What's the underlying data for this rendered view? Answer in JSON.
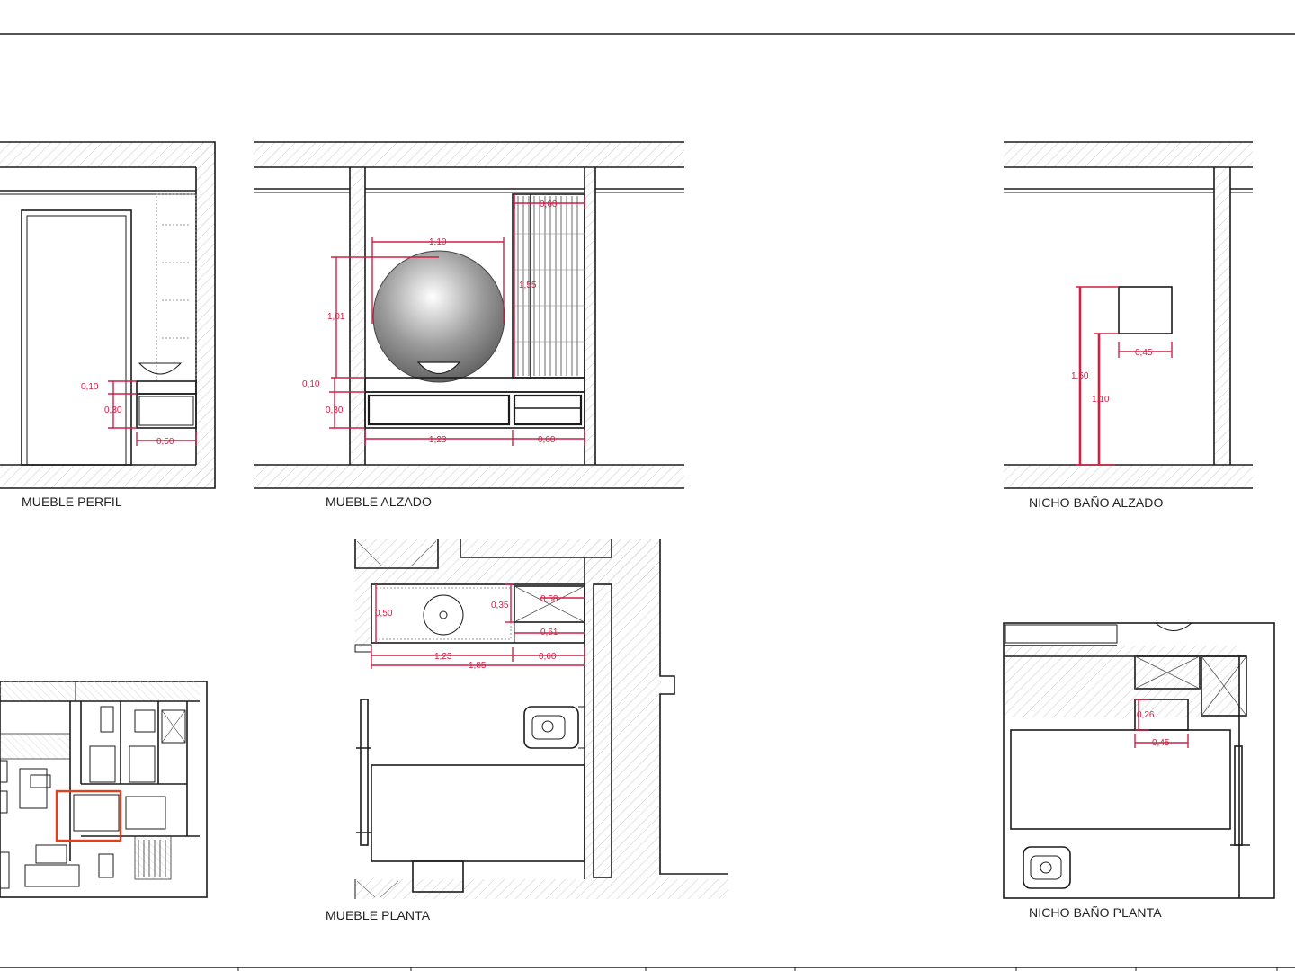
{
  "drawing_titles": {
    "profile": "MUEBLE PERFIL",
    "elevation": "MUEBLE ALZADO",
    "niche_elevation": "NICHO BAÑO ALZADO",
    "plan": "MUEBLE PLANTA",
    "niche_plan": "NICHO BAÑO PLANTA"
  },
  "dimensions": {
    "profile": {
      "top_gap": "0,10",
      "drawer_height": "0,30",
      "depth": "0,50"
    },
    "elevation": {
      "mirror_width": "1,10",
      "mirror_height": "1,01",
      "tall_unit_width": "0,60",
      "tall_unit_height": "1,55",
      "top_gap": "0,10",
      "drawer_height": "0,30",
      "left_module": "1,23",
      "right_module": "0,60"
    },
    "niche_elevation": {
      "total_height": "1,50",
      "base_height": "1,10",
      "width": "0,45"
    },
    "plan": {
      "depth": "0,50",
      "niche_depth": "0,35",
      "niche_width": "0,58",
      "cabinet_width": "0,61",
      "left_module": "1,23",
      "right_module": "0,60",
      "total_length": "1,85"
    },
    "niche_plan": {
      "depth": "0,26",
      "width": "0,45"
    }
  },
  "colors": {
    "dimension": "#d21f45",
    "line": "#1b1b1b",
    "highlight": "#e0401c"
  }
}
